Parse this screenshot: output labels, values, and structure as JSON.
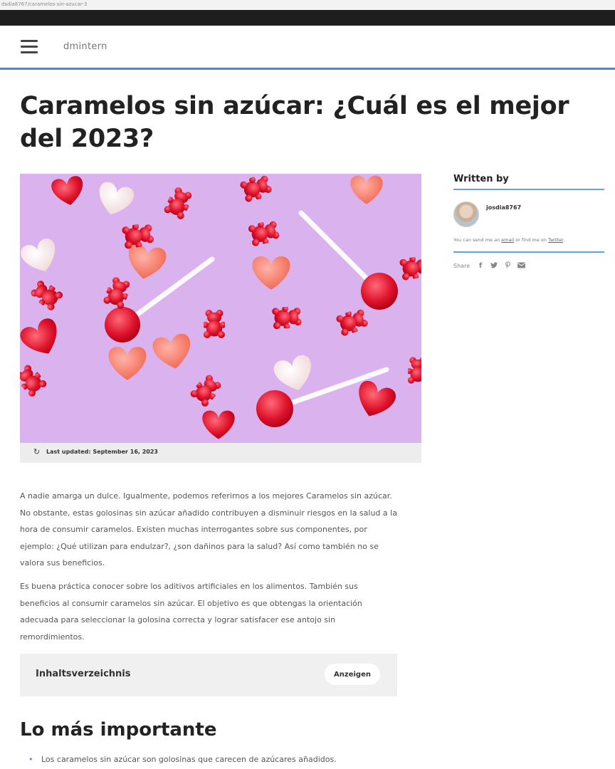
{
  "browser": {
    "url": "dsdia8767/caramelos-sin-azucar-3"
  },
  "header": {
    "site_name": "dmintern",
    "menu_icon": "hamburger-menu-icon"
  },
  "article": {
    "title": "Caramelos sin azúcar: ¿Cuál es el mejor del 2023?",
    "last_updated": "Last updated: September 16, 2023",
    "paragraph_1": "A nadie amarga un dulce. Igualmente, podemos referirnos a los mejores Caramelos sin azúcar. No obstante, estas golosinas sin azúcar añadido contribuyen a disminuir riesgos en la salud a la hora de consumir caramelos. Existen muchas interrogantes sobre sus componentes, por ejemplo: ¿Qué utilizan para endulzar?, ¿son dañinos para la salud? Así como también no se valora sus beneficios.",
    "paragraph_2": "Es buena práctica conocer sobre los aditivos artificiales en los alimentos. También sus beneficios al consumir caramelos sin azúcar. El objetivo es que obtengas la orientación adecuada para seleccionar la golosina correcta y lograr satisfacer ese antojo sin remordimientos.",
    "toc_label": "Inhaltsverzeichnis",
    "toc_button": "Anzeigen",
    "section_heading": "Lo más importante",
    "bullets": [
      "Los caramelos sin azúcar son golosinas que carecen de azúcares añadidos."
    ]
  },
  "sidebar": {
    "heading": "Written by",
    "author_name": "josdia8767",
    "contact_prefix": "You can send me an ",
    "contact_email": "email",
    "contact_middle": " or find me on ",
    "contact_twitter": "Twitter",
    "contact_suffix": ".",
    "share_label": "Share",
    "share_icons": [
      "facebook-icon",
      "twitter-icon",
      "pinterest-icon",
      "email-icon"
    ]
  },
  "colors": {
    "accent": "#4a86d4",
    "hero_background": "#d9b2ee",
    "candy_red": "#e0142c"
  }
}
